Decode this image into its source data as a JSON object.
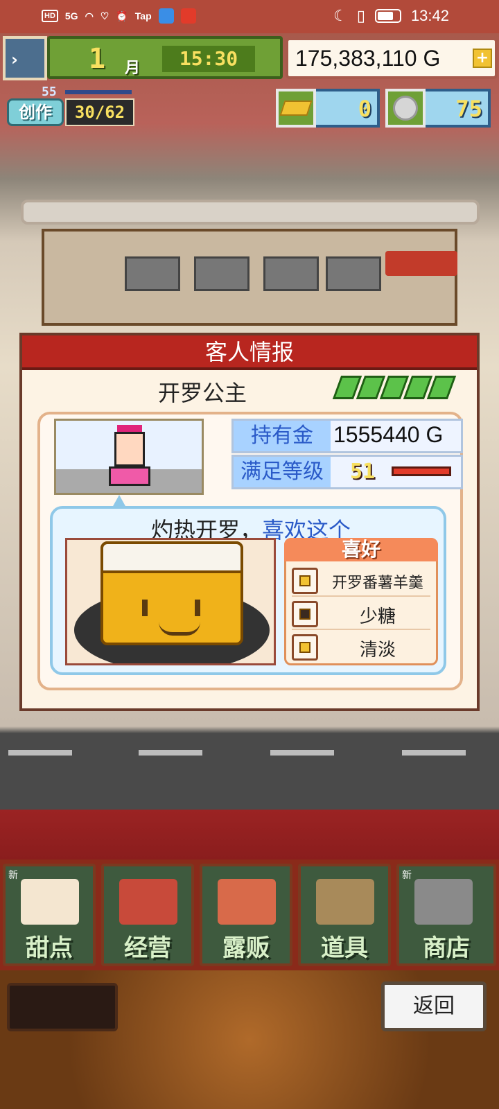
{
  "status_bar": {
    "network": "HD",
    "signal": "5G",
    "tap_label": "Tap",
    "time": "13:42"
  },
  "hud": {
    "month": "1",
    "month_unit": "月",
    "clock": "15:30",
    "money": "175,383,110 G",
    "add_money_label": "+",
    "create_level": "55",
    "create_label": "创作",
    "create_count": "30/62",
    "gold_bars": "0",
    "medals": "75",
    "side_arrow": "›"
  },
  "dialog": {
    "title": "客人情报",
    "customer_name": "开罗公主",
    "money_label": "持有金",
    "money_value": "1555440 G",
    "satisfaction_label": "满足等级",
    "satisfaction_level": "51",
    "quote_prefix": "灼热开罗，",
    "quote_highlight": "喜欢这个",
    "preferences_title": "喜好",
    "preferences": [
      "开罗番薯羊羹",
      "少糖",
      "清淡"
    ]
  },
  "menu": {
    "items": [
      {
        "label": "甜点",
        "badge": "新"
      },
      {
        "label": "经营",
        "badge": ""
      },
      {
        "label": "露贩",
        "badge": ""
      },
      {
        "label": "道具",
        "badge": ""
      },
      {
        "label": "商店",
        "badge": "新"
      }
    ]
  },
  "back_button": "返回",
  "colors": {
    "dialog_header": "#b8261f",
    "highlight_text": "#2a5ac8",
    "hud_green": "#6fa036",
    "menu_green": "#3e5a3e"
  }
}
